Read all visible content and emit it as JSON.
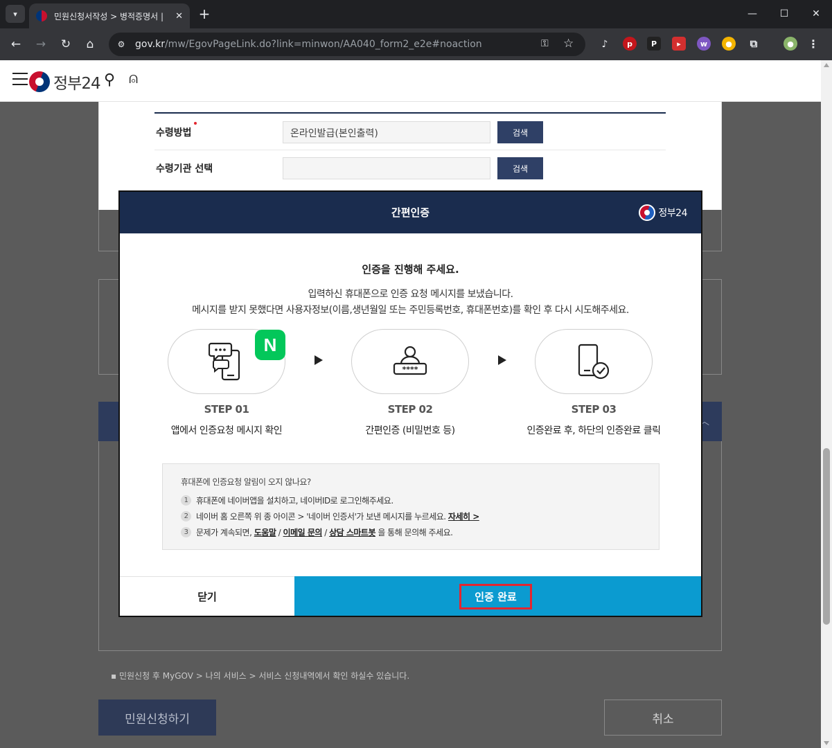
{
  "browser": {
    "tab_title": "민원신청서작성 > 병적증명서 |",
    "url_host": "gov.kr",
    "url_path": "/mw/EgovPageLink.do?link=minwon/AA040_form2_e2e#noaction"
  },
  "site": {
    "logo_text": "정부24"
  },
  "form": {
    "rows": [
      {
        "label": "수령방법",
        "value": "온라인발급(본인출력)",
        "button": "검색"
      },
      {
        "label": "수령기관 선택",
        "value": "",
        "button": "검색"
      }
    ]
  },
  "background": {
    "note": "민원신청 후 MyGOV > 나의 서비스 > 서비스 신청내역에서 확인 하실수 있습니다.",
    "submit_label": "민원신청하기",
    "cancel_label": "취소"
  },
  "modal": {
    "title": "간편인증",
    "logo_text": "정부24",
    "heading": "인증을 진행해 주세요.",
    "line1": "입력하신 휴대폰으로 인증 요청 메시지를 보냈습니다.",
    "line2": "메시지를 받지 못했다면 사용자정보(이름,생년월일 또는 주민등록번호, 휴대폰번호)를 확인 후 다시 시도해주세요.",
    "naver_badge": "N",
    "steps": [
      {
        "no": "STEP 01",
        "desc": "앱에서 인증요청 메시지 확인",
        "icon": "chat-phone-icon"
      },
      {
        "no": "STEP 02",
        "desc": "간편인증 (비밀번호 등)",
        "icon": "user-password-icon"
      },
      {
        "no": "STEP 03",
        "desc": "인증완료 후, 하단의 인증완료 클릭",
        "icon": "phone-check-icon"
      }
    ],
    "help": {
      "title": "휴대폰에 인증요청 알림이 오지 않나요?",
      "items": [
        {
          "num": "1",
          "text": "휴대폰에 네이버앱을 설치하고, 네이버ID로 로그인해주세요."
        },
        {
          "num": "2",
          "text_before": "네이버 홈 오른쪽 위 종 아이콘 > '네이버 인증서'가 보낸 메시지를 누르세요. ",
          "link": "자세히 >"
        },
        {
          "num": "3",
          "text_before": "문제가 계속되면, ",
          "link1": "도움말",
          "sep1": " / ",
          "link2": "이메일 문의",
          "sep2": " / ",
          "link3": "상담 스마트봇",
          "text_after": " 을 통해 문의해 주세요."
        }
      ]
    },
    "close_label": "닫기",
    "complete_label": "인증 완료"
  },
  "colors": {
    "header_navy": "#1a2c4e",
    "complete_blue": "#0b9bd0",
    "highlight_red": "#e3262f",
    "naver_green": "#03c75a"
  }
}
